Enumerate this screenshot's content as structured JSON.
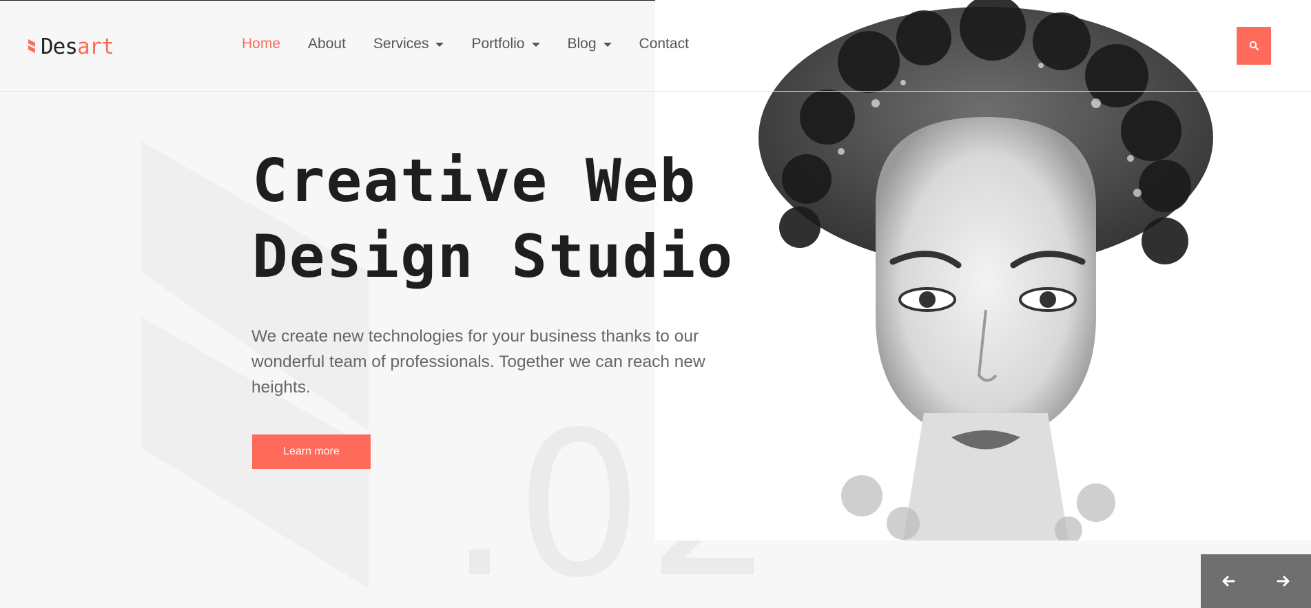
{
  "brand": {
    "name_prefix": "Des",
    "name_suffix": "art",
    "accent_color": "#ff6b5b"
  },
  "nav": {
    "items": [
      {
        "label": "Home",
        "active": true,
        "has_dropdown": false
      },
      {
        "label": "About",
        "active": false,
        "has_dropdown": false
      },
      {
        "label": "Services",
        "active": false,
        "has_dropdown": true
      },
      {
        "label": "Portfolio",
        "active": false,
        "has_dropdown": true
      },
      {
        "label": "Blog",
        "active": false,
        "has_dropdown": true
      },
      {
        "label": "Contact",
        "active": false,
        "has_dropdown": false
      }
    ]
  },
  "search": {
    "icon": "search-icon"
  },
  "hero": {
    "title_line1": "Creative Web",
    "title_line2": "Design Studio",
    "description": "We create new technologies for your business thanks to our wonderful team of professionals. Together we can reach new heights.",
    "cta_label": "Learn more",
    "slide_number": ".02"
  },
  "slider": {
    "prev_icon": "arrow-left-icon",
    "next_icon": "arrow-right-icon"
  }
}
